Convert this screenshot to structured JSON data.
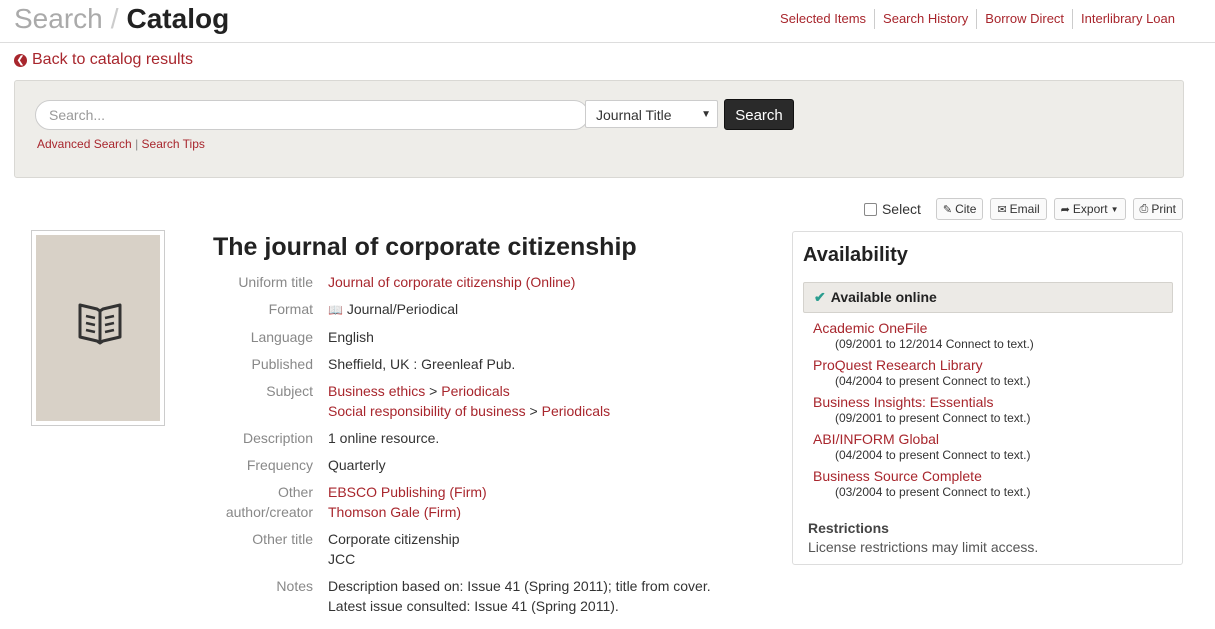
{
  "header": {
    "brand_search": "Search",
    "brand_sep": "/",
    "brand_catalog": "Catalog",
    "nav": [
      "Selected Items",
      "Search History",
      "Borrow Direct",
      "Interlibrary Loan"
    ]
  },
  "back_link": "Back to catalog results",
  "search": {
    "placeholder": "Search...",
    "field_selected": "Journal Title",
    "button": "Search",
    "advanced": "Advanced Search",
    "tips": "Search Tips"
  },
  "toolbar": {
    "select": "Select",
    "cite": "Cite",
    "email": "Email",
    "export": "Export",
    "print": "Print"
  },
  "record": {
    "title": "The journal of corporate citizenship",
    "uniform_title_label": "Uniform title",
    "uniform_title": "Journal of corporate citizenship (Online)",
    "format_label": "Format",
    "format": "Journal/Periodical",
    "language_label": "Language",
    "language": "English",
    "published_label": "Published",
    "published": "Sheffield, UK : Greenleaf Pub.",
    "subject_label": "Subject",
    "subjects": [
      {
        "main": "Business ethics",
        "sub": "Periodicals"
      },
      {
        "main": "Social responsibility of business",
        "sub": "Periodicals"
      }
    ],
    "subject_sep": ">",
    "description_label": "Description",
    "description": "1 online resource.",
    "frequency_label": "Frequency",
    "frequency": "Quarterly",
    "other_author_label_1": "Other",
    "other_author_label_2": "author/creator",
    "other_authors": [
      "EBSCO Publishing (Firm)",
      "Thomson Gale (Firm)"
    ],
    "other_title_label": "Other title",
    "other_titles": [
      "Corporate citizenship",
      "JCC"
    ],
    "notes_label": "Notes",
    "notes": [
      "Description based on: Issue 41 (Spring 2011); title from cover.",
      "Latest issue consulted: Issue 41 (Spring 2011)."
    ]
  },
  "availability": {
    "heading": "Availability",
    "status": "Available online",
    "databases": [
      {
        "name": "Academic OneFile",
        "coverage": "(09/2001 to 12/2014 Connect to text.)"
      },
      {
        "name": "ProQuest Research Library",
        "coverage": "(04/2004 to present Connect to text.)"
      },
      {
        "name": "Business Insights: Essentials",
        "coverage": "(09/2001 to present Connect to text.)"
      },
      {
        "name": "ABI/INFORM Global",
        "coverage": "(04/2004 to present Connect to text.)"
      },
      {
        "name": "Business Source Complete",
        "coverage": "(03/2004 to present Connect to text.)"
      }
    ],
    "restrictions_heading": "Restrictions",
    "restrictions_text": "License restrictions may limit access."
  }
}
